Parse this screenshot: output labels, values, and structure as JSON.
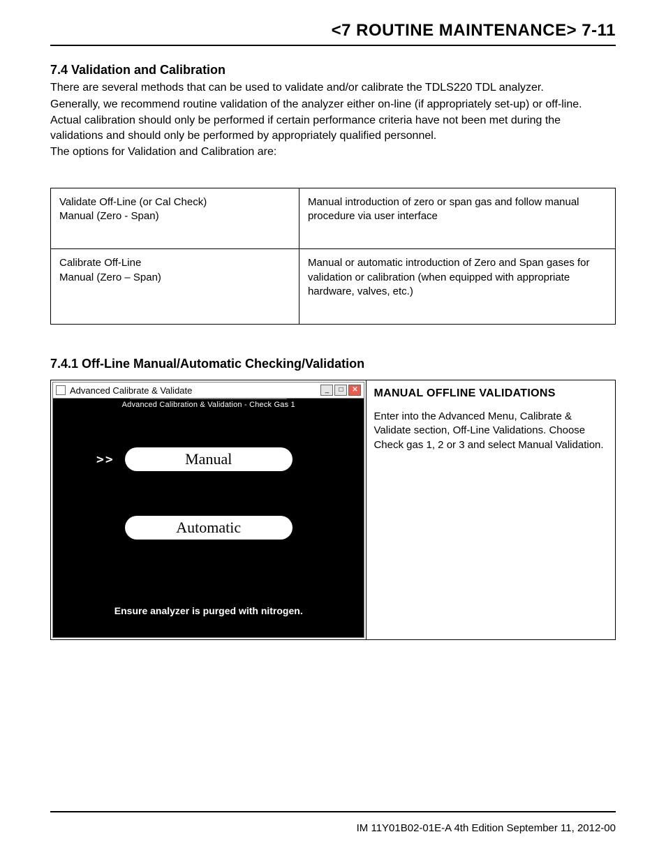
{
  "header": {
    "title": "<7 ROUTINE MAINTENANCE>  7-11"
  },
  "section": {
    "heading": "7.4   Validation and Calibration",
    "paragraphs": [
      "There are several methods that can be used to validate and/or calibrate the TDLS220 TDL analyzer.",
      "Generally, we recommend routine validation of the analyzer either on-line (if appropriately set-up) or off-line.",
      "Actual calibration should only be performed if certain performance criteria have not been met during the validations and should only be performed by appropriately qualified personnel.",
      "The options for Validation and Calibration are:"
    ]
  },
  "options_table": {
    "rows": [
      {
        "left_line1": "Validate Off-Line (or Cal Check)",
        "left_line2": "Manual (Zero - Span)",
        "right": "Manual introduction of zero or span gas and follow manual procedure via user interface"
      },
      {
        "left_line1": "Calibrate Off-Line",
        "left_line2": "Manual (Zero – Span)",
        "right": "Manual or automatic introduction of Zero and Span gases for validation or calibration (when equipped with appropriate hardware, valves, etc.)"
      }
    ]
  },
  "subsection": {
    "heading": "7.4.1  Off-Line Manual/Automatic Checking/Validation"
  },
  "dialog": {
    "title": "Advanced Calibrate & Validate",
    "subtitle": "Advanced Calibration & Validation - Check Gas 1",
    "marker": ">>",
    "option_manual": "Manual",
    "option_automatic": "Automatic",
    "note": "Ensure analyzer is purged with nitrogen.",
    "winbtn_min": "_",
    "winbtn_max": "□",
    "winbtn_close": "✕"
  },
  "offline_right": {
    "heading": "MANUAL OFFLINE VALIDATIONS",
    "paragraph": "Enter into the Advanced Menu, Calibrate & Validate section, Off-Line Validations. Choose Check gas 1, 2 or 3 and select Manual Validation."
  },
  "footer": {
    "text": "IM 11Y01B02-01E-A  4th Edition September 11, 2012-00"
  }
}
